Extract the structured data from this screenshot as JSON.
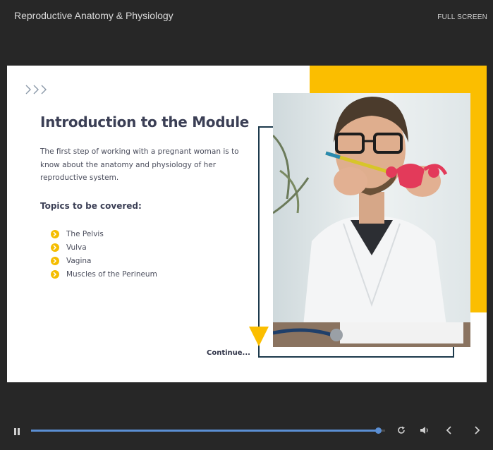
{
  "window": {
    "course_title": "Reproductive Anatomy & Physiology",
    "fullscreen_label": "FULL SCREEN"
  },
  "slide": {
    "heading": "Introduction to the Module",
    "intro_text": "The first step of working with a pregnant woman is to know about the anatomy and physiology of her reproductive system.",
    "topics_heading": "Topics to be covered:",
    "topics": [
      {
        "label": "The Pelvis"
      },
      {
        "label": "Vulva"
      },
      {
        "label": "Vagina"
      },
      {
        "label": "Muscles of the Perineum"
      }
    ],
    "continue_label": "Continue...",
    "photo_subject": "doctor holding anatomical uterus model",
    "colors": {
      "accent": "#fbbe00",
      "heading": "#3b3f55",
      "frame": "#1d3a4c"
    }
  },
  "player": {
    "progress": 0.98,
    "icons": [
      "pause-icon",
      "replay-icon",
      "volume-icon",
      "chevron-left-icon",
      "chevron-right-icon"
    ],
    "colors": {
      "progress": "#5b8fd4",
      "background": "#272727"
    }
  }
}
